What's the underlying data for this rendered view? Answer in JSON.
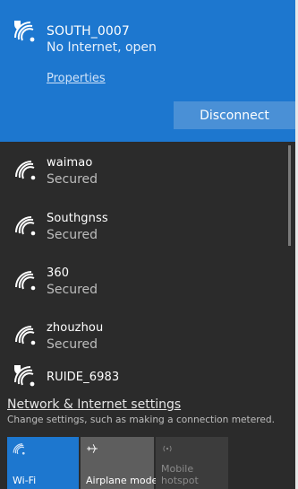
{
  "connected": {
    "name": "SOUTH_0007",
    "status": "No Internet, open",
    "properties_label": "Properties",
    "disconnect_label": "Disconnect",
    "icon": "wifi-warning-icon"
  },
  "networks": [
    {
      "name": "waimao",
      "status": "Secured",
      "icon": "wifi-icon"
    },
    {
      "name": "Southgnss",
      "status": "Secured",
      "icon": "wifi-icon"
    },
    {
      "name": "360",
      "status": "Secured",
      "icon": "wifi-icon"
    },
    {
      "name": "zhouzhou",
      "status": "Secured",
      "icon": "wifi-icon"
    },
    {
      "name": "RUIDE_6983",
      "status": "",
      "icon": "wifi-warning-icon"
    }
  ],
  "settings": {
    "link": "Network & Internet settings",
    "description": "Change settings, such as making a connection metered."
  },
  "tiles": {
    "wifi": {
      "label": "Wi-Fi",
      "icon": "wifi-icon"
    },
    "airplane": {
      "label": "Airplane mode",
      "icon": "airplane-icon"
    },
    "hotspot": {
      "label_line1": "Mobile",
      "label_line2": "hotspot",
      "icon": "hotspot-icon"
    }
  },
  "colors": {
    "accent": "#1d77cf",
    "panel": "#2b2b2b"
  }
}
